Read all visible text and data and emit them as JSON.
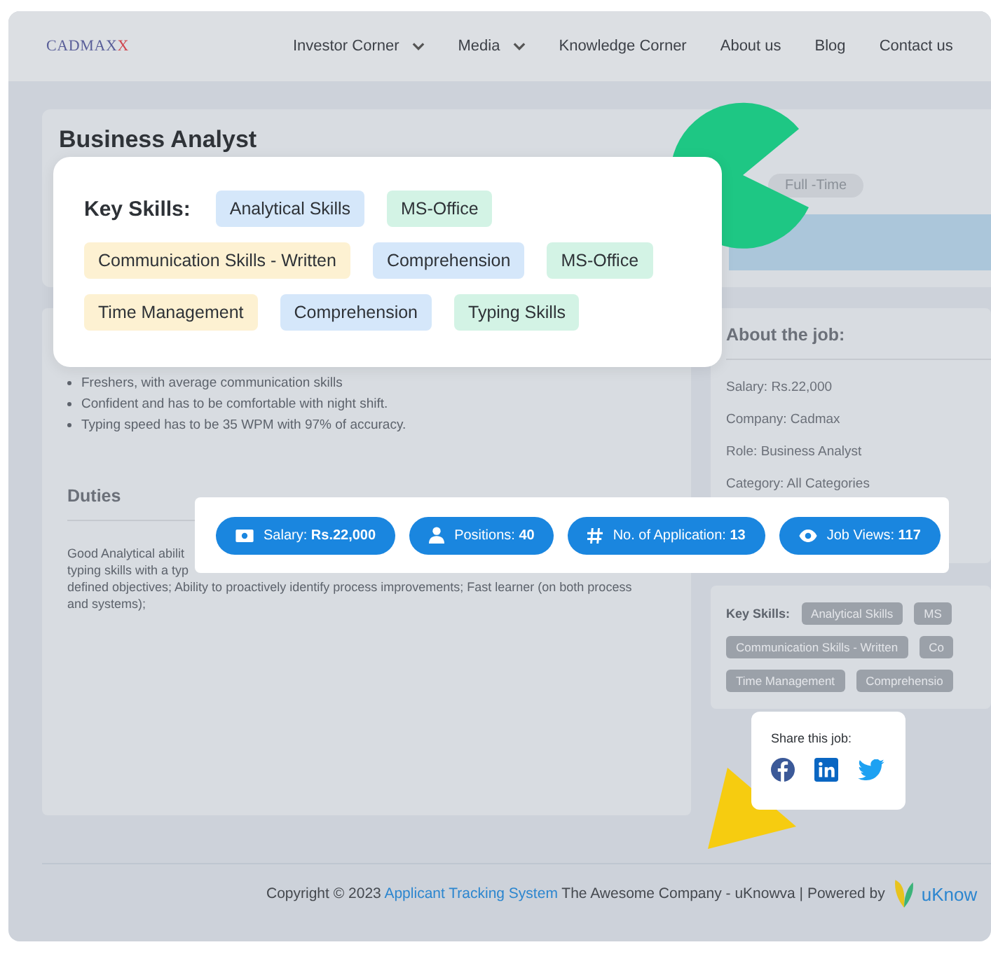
{
  "nav": {
    "logo": "CADMAXX",
    "items": [
      {
        "label": "Investor Corner",
        "dropdown": true
      },
      {
        "label": "Media",
        "dropdown": true
      },
      {
        "label": "Knowledge Corner",
        "dropdown": false
      },
      {
        "label": "About us",
        "dropdown": false
      },
      {
        "label": "Blog",
        "dropdown": false
      },
      {
        "label": "Contact us",
        "dropdown": false
      }
    ]
  },
  "job": {
    "title": "Business Analyst",
    "type_pill": "Full -Time",
    "requirements": [
      "Freshers, with average communication skills",
      "Confident and has to be comfortable with night shift.",
      "Typing speed has to be 35 WPM with 97% of accuracy."
    ],
    "duties_heading": "Duties",
    "duties_lines": [
      "Good Analytical abilit",
      "typing skills with a typ",
      "defined objectives; Ability to proactively identify process improvements; Fast learner (on both process",
      "and systems);"
    ]
  },
  "about": {
    "heading": "About the job:",
    "lines": [
      "Salary: Rs.22,000",
      "Company: Cadmax",
      "Role: Business Analyst",
      "Category: All Categories"
    ]
  },
  "side_skills": {
    "label": "Key Skills:",
    "rows": [
      [
        "Analytical Skills",
        "MS"
      ],
      [
        "Communication Skills - Written",
        "Co"
      ],
      [
        "Time Management",
        "Comprehensio"
      ]
    ]
  },
  "skills_card": {
    "label": "Key Skills:",
    "rows": [
      [
        {
          "text": "Analytical Skills",
          "color": "#d5e7fa"
        },
        {
          "text": "MS-Office",
          "color": "#d3f3e5"
        }
      ],
      [
        {
          "text": "Communication Skills - Written",
          "color": "#fdf1d2"
        },
        {
          "text": "Comprehension",
          "color": "#d5e7fa"
        },
        {
          "text": "MS-Office",
          "color": "#d3f3e5"
        }
      ],
      [
        {
          "text": "Time Management",
          "color": "#fdf1d2"
        },
        {
          "text": "Comprehension",
          "color": "#d5e7fa"
        },
        {
          "text": "Typing Skills",
          "color": "#d3f3e5"
        }
      ]
    ]
  },
  "stats": [
    {
      "kind": "money",
      "text": "Salary: **Rs.22,000**"
    },
    {
      "kind": "person",
      "text": "Positions: **40**"
    },
    {
      "kind": "hash",
      "text": "No. of Application: **13**"
    },
    {
      "kind": "eye",
      "text": "Job Views: **117**"
    }
  ],
  "share": {
    "title": "Share this job:",
    "networks": [
      {
        "kind": "facebook"
      },
      {
        "kind": "linkedin"
      },
      {
        "kind": "twitter"
      }
    ]
  },
  "footer": {
    "prefix": "Copyright © 2023",
    "link": "Applicant Tracking System",
    "suffix": "The Awesome Company - uKnowva | Powered by",
    "brand": "uKnow"
  }
}
